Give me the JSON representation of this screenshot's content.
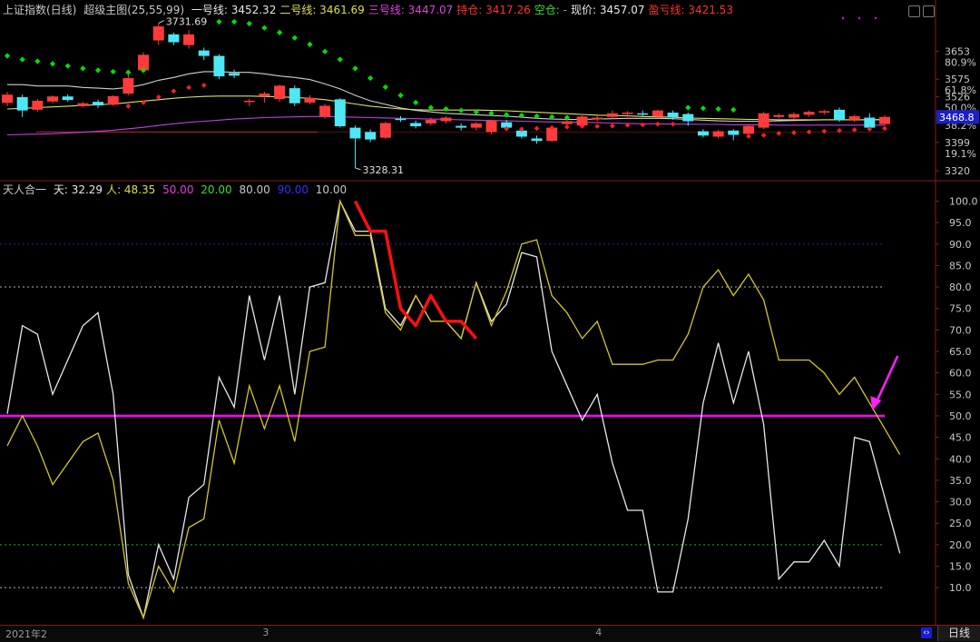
{
  "colors": {
    "background": "#000000",
    "separator": "#8b1a1a",
    "white_line": "#e8e8e8",
    "yellow_line": "#d4c822",
    "magenta_line": "#ff00ff",
    "red_highlight": "#ff1010",
    "candle_up": "#ff3b3b",
    "candle_down": "#4de7f5",
    "green_dots": "#00e000",
    "red_dots": "#ff2020",
    "level_line": "#a02020",
    "ma_purple": "#c040e0",
    "ma_yellow": "#e0e060",
    "ma_white": "#d0d0d0"
  },
  "top_panel": {
    "index_name": "上证指数(日线)",
    "indicator_name": "超级主图(25,55,99)",
    "legend": [
      {
        "label": "一号线:",
        "value": "3452.32",
        "color": "#e8e8e8"
      },
      {
        "label": "二号线:",
        "value": "3461.69",
        "color": "#e0e040"
      },
      {
        "label": "三号线:",
        "value": "3447.07",
        "color": "#e040e0"
      },
      {
        "label": "持仓:",
        "value": "3417.26",
        "color": "#ff3030"
      },
      {
        "label": "空仓:",
        "value": "-",
        "color": "#30e030"
      },
      {
        "label": "现价:",
        "value": "3457.07",
        "color": "#e8e8e8"
      },
      {
        "label": "盈亏线:",
        "value": "3421.53",
        "color": "#ff3030"
      }
    ],
    "high_label": "3731.69",
    "low_label": "3328.31",
    "current_price_tag": "3468.8",
    "y_axis": [
      {
        "value": "3653",
        "pct": "80.9%",
        "color": "#c8c8c8"
      },
      {
        "value": "3575",
        "pct": "61.8%",
        "color": "#c8c8c8"
      },
      {
        "value": "3526",
        "pct": "50.0%",
        "color": "#c8c8c8"
      },
      {
        "value": "3477",
        "pct": "38.2%",
        "color": "#c8c8c8"
      },
      {
        "value": "3399",
        "pct": "19.1%",
        "color": "#c8c8c8"
      },
      {
        "value": "3320",
        "pct": "",
        "color": "#c8c8c8"
      }
    ]
  },
  "bottom_panel": {
    "indicator_name": "天人合一",
    "legend": [
      {
        "label": "天:",
        "value": "32.29",
        "color": "#e8e8e8"
      },
      {
        "label": "人:",
        "value": "48.35",
        "color": "#e0e040"
      },
      {
        "label": "",
        "value": "50.00",
        "color": "#e040e0"
      },
      {
        "label": "",
        "value": "20.00",
        "color": "#30e030"
      },
      {
        "label": "",
        "value": "80.00",
        "color": "#c8c8c8"
      },
      {
        "label": "",
        "value": "90.00",
        "color": "#3030ff"
      },
      {
        "label": "",
        "value": "10.00",
        "color": "#c8c8c8"
      }
    ]
  },
  "x_axis": {
    "labels": [
      {
        "text": "2021年2",
        "index": 0
      },
      {
        "text": "3",
        "index": 17
      },
      {
        "text": "4",
        "index": 39
      }
    ],
    "period_tab": "日线"
  },
  "chart_data": [
    {
      "type": "candlestick",
      "title": "超级主图(25,55,99)",
      "ylim": [
        3310,
        3740
      ],
      "y_ticks": [
        3653,
        3575,
        3526,
        3477,
        3399,
        3320
      ],
      "candles": [
        {
          "o": 3509,
          "c": 3532,
          "h": 3540,
          "l": 3500
        },
        {
          "o": 3525,
          "c": 3488,
          "h": 3532,
          "l": 3470
        },
        {
          "o": 3490,
          "c": 3515,
          "h": 3520,
          "l": 3485
        },
        {
          "o": 3513,
          "c": 3527,
          "h": 3530,
          "l": 3508
        },
        {
          "o": 3527,
          "c": 3517,
          "h": 3533,
          "l": 3512
        },
        {
          "o": 3500,
          "c": 3508,
          "h": 3512,
          "l": 3496
        },
        {
          "o": 3512,
          "c": 3502,
          "h": 3518,
          "l": 3495
        },
        {
          "o": 3504,
          "c": 3528,
          "h": 3530,
          "l": 3500
        },
        {
          "o": 3535,
          "c": 3578,
          "h": 3595,
          "l": 3530
        },
        {
          "o": 3600,
          "c": 3643,
          "h": 3650,
          "l": 3595
        },
        {
          "o": 3683,
          "c": 3722,
          "h": 3731,
          "l": 3670
        },
        {
          "o": 3700,
          "c": 3678,
          "h": 3705,
          "l": 3670
        },
        {
          "o": 3670,
          "c": 3700,
          "h": 3712,
          "l": 3660
        },
        {
          "o": 3655,
          "c": 3640,
          "h": 3663,
          "l": 3628
        },
        {
          "o": 3640,
          "c": 3583,
          "h": 3645,
          "l": 3575
        },
        {
          "o": 3592,
          "c": 3585,
          "h": 3602,
          "l": 3578
        },
        {
          "o": 3512,
          "c": 3515,
          "h": 3520,
          "l": 3500
        },
        {
          "o": 3528,
          "c": 3535,
          "h": 3540,
          "l": 3510
        },
        {
          "o": 3520,
          "c": 3557,
          "h": 3560,
          "l": 3512
        },
        {
          "o": 3550,
          "c": 3508,
          "h": 3558,
          "l": 3500
        },
        {
          "o": 3510,
          "c": 3523,
          "h": 3530,
          "l": 3505
        },
        {
          "o": 3471,
          "c": 3501,
          "h": 3506,
          "l": 3465
        },
        {
          "o": 3519,
          "c": 3444,
          "h": 3522,
          "l": 3440
        },
        {
          "o": 3440,
          "c": 3410,
          "h": 3446,
          "l": 3328
        },
        {
          "o": 3428,
          "c": 3407,
          "h": 3435,
          "l": 3400
        },
        {
          "o": 3412,
          "c": 3453,
          "h": 3457,
          "l": 3408
        },
        {
          "o": 3465,
          "c": 3464,
          "h": 3472,
          "l": 3456
        },
        {
          "o": 3453,
          "c": 3444,
          "h": 3460,
          "l": 3438
        },
        {
          "o": 3452,
          "c": 3462,
          "h": 3468,
          "l": 3446
        },
        {
          "o": 3458,
          "c": 3468,
          "h": 3472,
          "l": 3452
        },
        {
          "o": 3445,
          "c": 3440,
          "h": 3452,
          "l": 3432
        },
        {
          "o": 3440,
          "c": 3452,
          "h": 3456,
          "l": 3432
        },
        {
          "o": 3428,
          "c": 3460,
          "h": 3462,
          "l": 3422
        },
        {
          "o": 3455,
          "c": 3440,
          "h": 3462,
          "l": 3432
        },
        {
          "o": 3432,
          "c": 3415,
          "h": 3438,
          "l": 3410
        },
        {
          "o": 3410,
          "c": 3403,
          "h": 3418,
          "l": 3395
        },
        {
          "o": 3403,
          "c": 3440,
          "h": 3445,
          "l": 3400
        },
        {
          "o": 3450,
          "c": 3458,
          "h": 3462,
          "l": 3446
        },
        {
          "o": 3446,
          "c": 3471,
          "h": 3478,
          "l": 3440
        },
        {
          "o": 3463,
          "c": 3468,
          "h": 3473,
          "l": 3458
        },
        {
          "o": 3470,
          "c": 3480,
          "h": 3488,
          "l": 3465
        },
        {
          "o": 3478,
          "c": 3482,
          "h": 3486,
          "l": 3470
        },
        {
          "o": 3480,
          "c": 3477,
          "h": 3488,
          "l": 3472
        },
        {
          "o": 3471,
          "c": 3488,
          "h": 3490,
          "l": 3468
        },
        {
          "o": 3482,
          "c": 3468,
          "h": 3488,
          "l": 3462
        },
        {
          "o": 3478,
          "c": 3458,
          "h": 3482,
          "l": 3445
        },
        {
          "o": 3430,
          "c": 3418,
          "h": 3436,
          "l": 3413
        },
        {
          "o": 3415,
          "c": 3430,
          "h": 3434,
          "l": 3410
        },
        {
          "o": 3432,
          "c": 3420,
          "h": 3436,
          "l": 3405
        },
        {
          "o": 3423,
          "c": 3445,
          "h": 3448,
          "l": 3420
        },
        {
          "o": 3440,
          "c": 3480,
          "h": 3484,
          "l": 3436
        },
        {
          "o": 3470,
          "c": 3475,
          "h": 3480,
          "l": 3466
        },
        {
          "o": 3468,
          "c": 3478,
          "h": 3483,
          "l": 3462
        },
        {
          "o": 3476,
          "c": 3484,
          "h": 3488,
          "l": 3470
        },
        {
          "o": 3482,
          "c": 3486,
          "h": 3490,
          "l": 3476
        },
        {
          "o": 3490,
          "c": 3462,
          "h": 3496,
          "l": 3456
        },
        {
          "o": 3462,
          "c": 3472,
          "h": 3476,
          "l": 3456
        },
        {
          "o": 3468,
          "c": 3440,
          "h": 3480,
          "l": 3430
        },
        {
          "o": 3450,
          "c": 3470,
          "h": 3474,
          "l": 3446
        }
      ],
      "series": [
        {
          "name": "一号线",
          "values": [
            3560,
            3560,
            3556,
            3556,
            3556,
            3552,
            3550,
            3548,
            3552,
            3560,
            3572,
            3580,
            3590,
            3596,
            3596,
            3594,
            3594,
            3590,
            3584,
            3580,
            3574,
            3562,
            3548,
            3530,
            3515,
            3505,
            3495,
            3488,
            3484,
            3480,
            3478,
            3476,
            3474,
            3472,
            3469,
            3466,
            3464,
            3463,
            3463,
            3464,
            3465,
            3466,
            3466,
            3466,
            3465,
            3463,
            3461,
            3459,
            3458,
            3458,
            3458,
            3459,
            3460,
            3461,
            3462,
            3462,
            3462,
            3462,
            3463
          ]
        },
        {
          "name": "二号线",
          "values": [
            3492,
            3494,
            3496,
            3498,
            3500,
            3502,
            3504,
            3506,
            3510,
            3514,
            3518,
            3522,
            3525,
            3527,
            3528,
            3528,
            3528,
            3527,
            3526,
            3524,
            3522,
            3518,
            3512,
            3506,
            3500,
            3496,
            3492,
            3490,
            3489,
            3489,
            3489,
            3489,
            3488,
            3487,
            3485,
            3483,
            3481,
            3479,
            3477,
            3475,
            3474,
            3473,
            3471,
            3470,
            3469,
            3467,
            3466,
            3465,
            3464,
            3463,
            3463,
            3462,
            3462,
            3462,
            3462,
            3462,
            3462,
            3462,
            3462
          ]
        },
        {
          "name": "三号线",
          "values": [
            3420,
            3421,
            3422,
            3423,
            3425,
            3427,
            3430,
            3433,
            3437,
            3441,
            3446,
            3451,
            3455,
            3458,
            3461,
            3464,
            3466,
            3468,
            3469,
            3470,
            3471,
            3471,
            3470,
            3469,
            3468,
            3467,
            3466,
            3465,
            3464,
            3463,
            3462,
            3461,
            3460,
            3459,
            3458,
            3457,
            3456,
            3456,
            3455,
            3454,
            3453,
            3452,
            3451,
            3451,
            3450,
            3450,
            3449,
            3449,
            3448,
            3448,
            3448,
            3447,
            3447,
            3447,
            3447,
            3447,
            3447,
            3447,
            3447
          ]
        }
      ],
      "sar_green": [
        [
          0,
          3640
        ],
        [
          1,
          3630
        ],
        [
          2,
          3625
        ],
        [
          3,
          3618
        ],
        [
          4,
          3612
        ],
        [
          5,
          3605
        ],
        [
          6,
          3600
        ],
        [
          7,
          3596
        ],
        [
          8,
          3594
        ],
        [
          9,
          3600
        ],
        [
          14,
          3735
        ],
        [
          15,
          3735
        ],
        [
          16,
          3730
        ],
        [
          17,
          3718
        ],
        [
          18,
          3705
        ],
        [
          19,
          3690
        ],
        [
          20,
          3672
        ],
        [
          21,
          3652
        ],
        [
          22,
          3630
        ],
        [
          23,
          3605
        ],
        [
          24,
          3578
        ],
        [
          25,
          3553
        ],
        [
          26,
          3530
        ],
        [
          27,
          3510
        ],
        [
          28,
          3496
        ],
        [
          29,
          3492
        ],
        [
          30,
          3488
        ],
        [
          31,
          3484
        ],
        [
          32,
          3480
        ],
        [
          33,
          3476
        ],
        [
          34,
          3474
        ],
        [
          35,
          3472
        ],
        [
          36,
          3470
        ],
        [
          37,
          3468
        ],
        [
          45,
          3496
        ],
        [
          46,
          3494
        ],
        [
          47,
          3492
        ],
        [
          48,
          3490
        ]
      ],
      "sar_red": [
        [
          8,
          3500
        ],
        [
          9,
          3510
        ],
        [
          10,
          3525
        ],
        [
          11,
          3542
        ],
        [
          12,
          3552
        ],
        [
          13,
          3558
        ],
        [
          33,
          3437
        ],
        [
          34,
          3436
        ],
        [
          35,
          3438
        ],
        [
          36,
          3440
        ],
        [
          37,
          3442
        ],
        [
          38,
          3444
        ],
        [
          39,
          3444
        ],
        [
          40,
          3445
        ],
        [
          41,
          3447
        ],
        [
          42,
          3448
        ],
        [
          43,
          3450
        ],
        [
          44,
          3450
        ],
        [
          49,
          3416
        ],
        [
          50,
          3419
        ],
        [
          51,
          3424
        ],
        [
          52,
          3426
        ],
        [
          53,
          3428
        ],
        [
          54,
          3430
        ],
        [
          55,
          3432
        ],
        [
          56,
          3434
        ],
        [
          57,
          3436
        ],
        [
          58,
          3438
        ]
      ],
      "level_line": 3428
    },
    {
      "type": "line",
      "title": "天人合一",
      "ylim": [
        2,
        102
      ],
      "y_ticks": [
        100,
        95,
        90,
        85,
        80,
        75,
        70,
        65,
        60,
        55,
        50,
        45,
        40,
        35,
        30,
        25,
        20,
        15,
        10
      ],
      "reference_lines": [
        {
          "value": 90,
          "color": "#2020c0",
          "style": "dotted"
        },
        {
          "value": 80,
          "color": "#b0b0b0",
          "style": "dotted"
        },
        {
          "value": 50,
          "color": "#ff00ff",
          "style": "solid"
        },
        {
          "value": 20,
          "color": "#20b020",
          "style": "dotted"
        },
        {
          "value": 10,
          "color": "#b0b0b0",
          "style": "dotted"
        }
      ],
      "series": [
        {
          "name": "天",
          "values": [
            50.5,
            71,
            69,
            55,
            63,
            71,
            74,
            55,
            13,
            3,
            20,
            12,
            31,
            34,
            59,
            52,
            78,
            63,
            78,
            55,
            80,
            81,
            100,
            93,
            93,
            75,
            71,
            78,
            72,
            72,
            68,
            81,
            72,
            76,
            88,
            87,
            65,
            57,
            49,
            55,
            39,
            28,
            28,
            9,
            9,
            26,
            53,
            67,
            53,
            65,
            48,
            12,
            16,
            16,
            21,
            15,
            45,
            44,
            31,
            18
          ],
          "highlight": [
            {
              "from": 22,
              "to": 31,
              "values": [
                100,
                93,
                93,
                75,
                71,
                78,
                72,
                72,
                68
              ],
              "color": "#ff1010"
            }
          ]
        },
        {
          "name": "人",
          "values": [
            43,
            50,
            43,
            34,
            39,
            44,
            46,
            35,
            11,
            3,
            15,
            9,
            24,
            26,
            49,
            39,
            57,
            47,
            57,
            44,
            65,
            66,
            100,
            92,
            92,
            74,
            70,
            78,
            72,
            72,
            68,
            81,
            71,
            79,
            90,
            91,
            78,
            74,
            68,
            72,
            62,
            62,
            62,
            63,
            63,
            69,
            80,
            84,
            78,
            83,
            77,
            63,
            63,
            63,
            60,
            55,
            59,
            53,
            47,
            41
          ]
        }
      ],
      "arrow_annotation": {
        "index": 57,
        "value": 50
      }
    }
  ]
}
